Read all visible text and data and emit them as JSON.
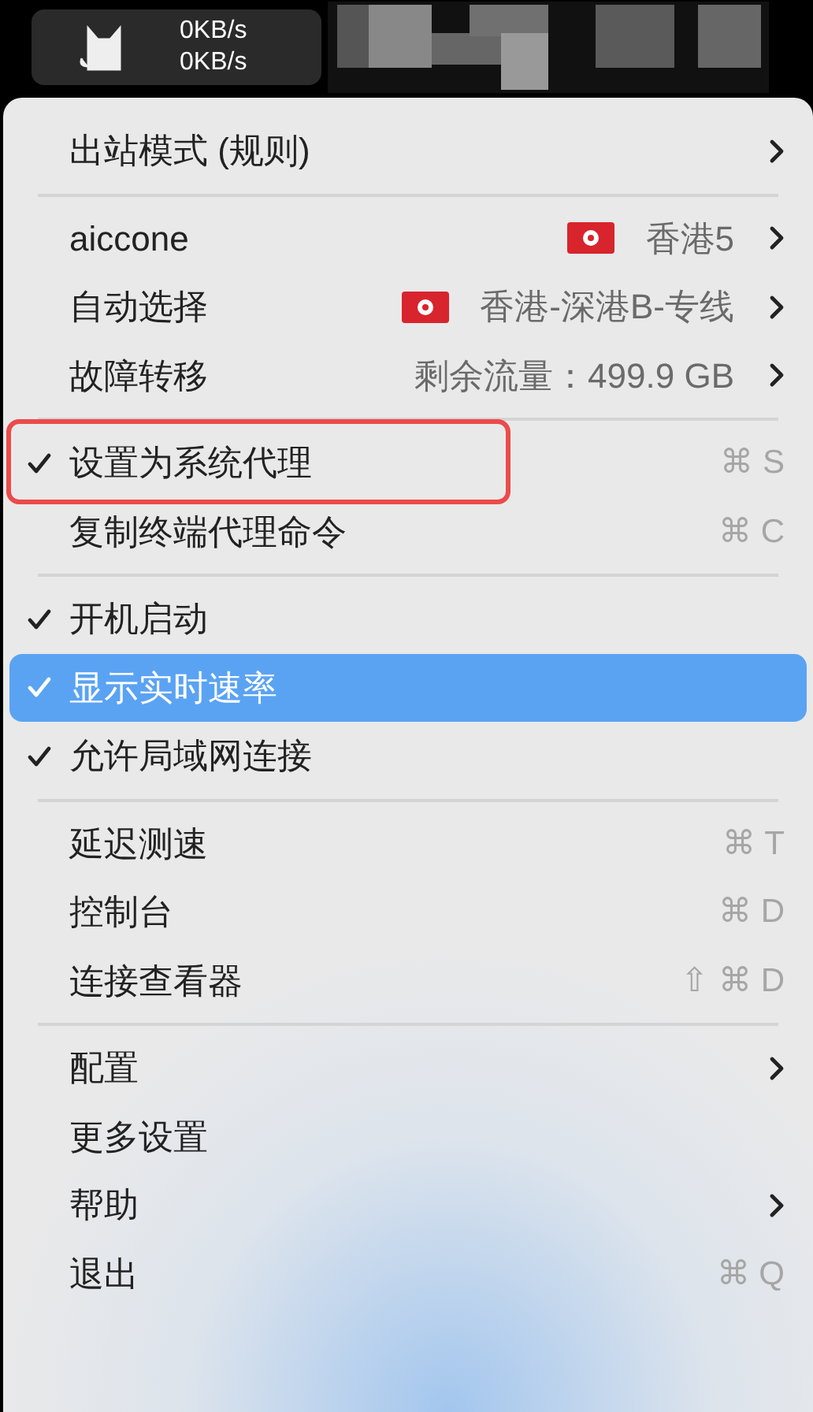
{
  "menu_bar": {
    "speed_up": "0KB/s",
    "speed_down": "0KB/s"
  },
  "menu": [
    {
      "kind": "item",
      "label": "出站模式 (规则)",
      "checked": false,
      "selected": false,
      "submenu": true
    },
    {
      "kind": "separator"
    },
    {
      "kind": "item",
      "label": "aiccone",
      "detail": "香港5",
      "flag": true,
      "checked": false,
      "selected": false,
      "submenu": true
    },
    {
      "kind": "item",
      "label": "自动选择",
      "detail": "香港-深港B-专线",
      "flag": true,
      "checked": false,
      "selected": false,
      "submenu": true
    },
    {
      "kind": "item",
      "label": "故障转移",
      "detail": "剩余流量：499.9 GB",
      "checked": false,
      "selected": false,
      "submenu": true
    },
    {
      "kind": "separator"
    },
    {
      "kind": "item",
      "label": "设置为系统代理",
      "shortcut": "⌘ S",
      "checked": true,
      "selected": false,
      "annotated": true
    },
    {
      "kind": "item",
      "label": "复制终端代理命令",
      "shortcut": "⌘ C",
      "checked": false,
      "selected": false
    },
    {
      "kind": "separator"
    },
    {
      "kind": "item",
      "label": "开机启动",
      "checked": true,
      "selected": false
    },
    {
      "kind": "item",
      "label": "显示实时速率",
      "checked": true,
      "selected": true
    },
    {
      "kind": "item",
      "label": "允许局域网连接",
      "checked": true,
      "selected": false
    },
    {
      "kind": "separator"
    },
    {
      "kind": "item",
      "label": "延迟测速",
      "shortcut": "⌘ T",
      "checked": false,
      "selected": false
    },
    {
      "kind": "item",
      "label": "控制台",
      "shortcut": "⌘ D",
      "checked": false,
      "selected": false
    },
    {
      "kind": "item",
      "label": "连接查看器",
      "shortcut": "⇧ ⌘ D",
      "checked": false,
      "selected": false
    },
    {
      "kind": "separator"
    },
    {
      "kind": "item",
      "label": "配置",
      "checked": false,
      "selected": false,
      "submenu": true
    },
    {
      "kind": "item",
      "label": "更多设置",
      "checked": false,
      "selected": false
    },
    {
      "kind": "item",
      "label": "帮助",
      "checked": false,
      "selected": false,
      "submenu": true
    },
    {
      "kind": "item",
      "label": "退出",
      "shortcut": "⌘ Q",
      "checked": false,
      "selected": false
    }
  ]
}
